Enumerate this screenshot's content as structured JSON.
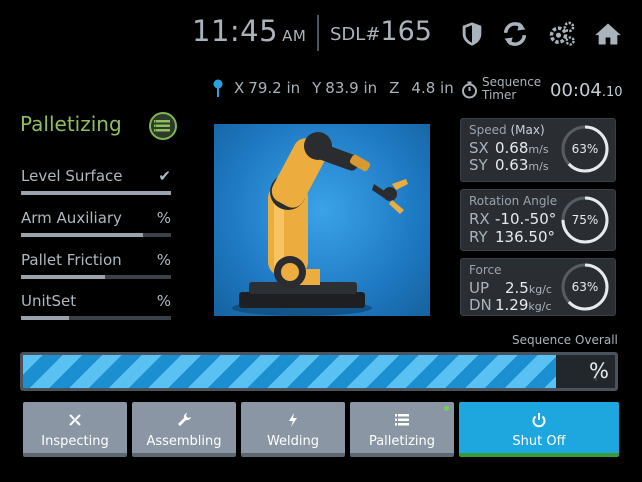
{
  "header": {
    "time": "11:45",
    "ampm": "AM",
    "sdl_label": "SDL#",
    "sdl_number": "165",
    "icons": [
      "shield-icon",
      "refresh-icon",
      "settings-icon",
      "home-icon"
    ]
  },
  "coords": {
    "x_label": "X",
    "x_value": "79.2 in",
    "y_label": "Y",
    "y_value": "83.9 in",
    "z_label": "Z",
    "z_value": "4.8 in"
  },
  "sequence_timer": {
    "label_line1": "Sequence",
    "label_line2": "Timer",
    "value_main": "00:04",
    "value_frac": ".10"
  },
  "mode": {
    "title": "Palletizing",
    "icon": "list-icon"
  },
  "checks": [
    {
      "label": "Level Surface",
      "value": "✔",
      "fill": 1.0
    },
    {
      "label": "Arm Auxiliary",
      "value": "%",
      "fill": 0.81
    },
    {
      "label": "Pallet Friction",
      "value": "%",
      "fill": 0.56
    },
    {
      "label": "UnitSet",
      "value": "%",
      "fill": 0.32
    }
  ],
  "cards": {
    "speed": {
      "title": "Speed",
      "title_extra": "(Max)",
      "r1_key": "SX",
      "r1_val": "0.68",
      "r1_unit": "m/s",
      "r2_key": "SY",
      "r2_val": "0.63",
      "r2_unit": "m/s",
      "gauge": "63%",
      "gauge_value": 0.63
    },
    "rotation": {
      "title": "Rotation Angle",
      "r1_key": "RX",
      "r1_val": "-10.-50°",
      "r2_key": "RY",
      "r2_val": "136.50°",
      "gauge": "75%",
      "gauge_value": 0.75
    },
    "force": {
      "title": "Force",
      "r1_key": "UP",
      "r1_val": "2.5",
      "r1_unit": "kg/c",
      "r2_key": "DN",
      "r2_val": "1.29",
      "r2_unit": "kg/c",
      "gauge": "63%",
      "gauge_value": 0.63
    }
  },
  "overall": {
    "label": "Sequence Overall",
    "pct": "%",
    "progress": 0.9
  },
  "buttons": [
    {
      "label": "Inspecting",
      "icon": "inspect-icon"
    },
    {
      "label": "Assembling",
      "icon": "wrench-icon"
    },
    {
      "label": "Welding",
      "icon": "bolt-icon"
    },
    {
      "label": "Palletizing",
      "icon": "list-icon"
    },
    {
      "label": "Shut Off",
      "icon": "power-icon"
    }
  ],
  "colors": {
    "accent_green": "#8fbf5a",
    "accent_blue": "#1ea6de",
    "stripe_light": "#59c2f2",
    "stripe_dark": "#1c8fd0"
  }
}
